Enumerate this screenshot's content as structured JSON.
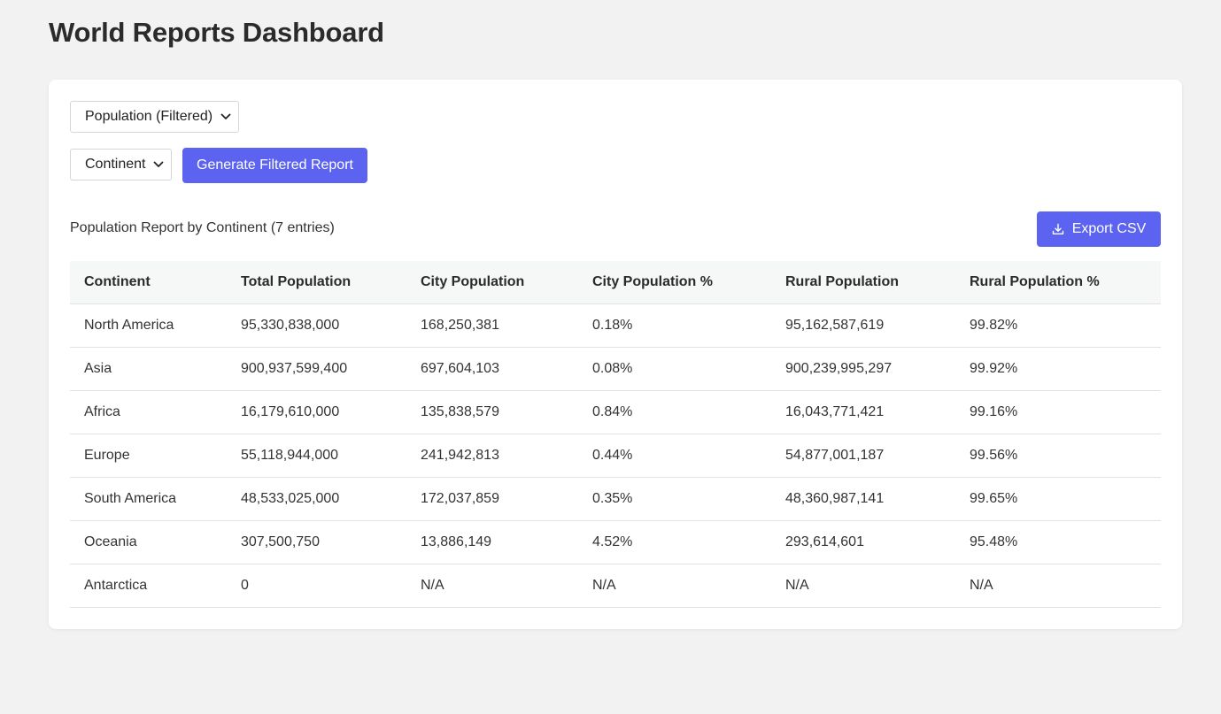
{
  "page": {
    "title": "World Reports Dashboard"
  },
  "controls": {
    "report_type": {
      "selected": "Population (Filtered)"
    },
    "group_by": {
      "selected": "Continent"
    },
    "generate_label": "Generate Filtered Report"
  },
  "report": {
    "heading": "Population Report by Continent (7 entries)",
    "export_label": "Export CSV",
    "export_icon": "download-icon",
    "columns": [
      "Continent",
      "Total Population",
      "City Population",
      "City Population %",
      "Rural Population",
      "Rural Population %"
    ],
    "rows": [
      [
        "North America",
        "95,330,838,000",
        "168,250,381",
        "0.18%",
        "95,162,587,619",
        "99.82%"
      ],
      [
        "Asia",
        "900,937,599,400",
        "697,604,103",
        "0.08%",
        "900,239,995,297",
        "99.92%"
      ],
      [
        "Africa",
        "16,179,610,000",
        "135,838,579",
        "0.84%",
        "16,043,771,421",
        "99.16%"
      ],
      [
        "Europe",
        "55,118,944,000",
        "241,942,813",
        "0.44%",
        "54,877,001,187",
        "99.56%"
      ],
      [
        "South America",
        "48,533,025,000",
        "172,037,859",
        "0.35%",
        "48,360,987,141",
        "99.65%"
      ],
      [
        "Oceania",
        "307,500,750",
        "13,886,149",
        "4.52%",
        "293,614,601",
        "95.48%"
      ],
      [
        "Antarctica",
        "0",
        "N/A",
        "N/A",
        "N/A",
        "N/A"
      ]
    ]
  },
  "colors": {
    "accent": "#5b63f0",
    "background": "#f2f2f2",
    "card": "#ffffff",
    "table_header_bg": "#f6f7f7"
  }
}
